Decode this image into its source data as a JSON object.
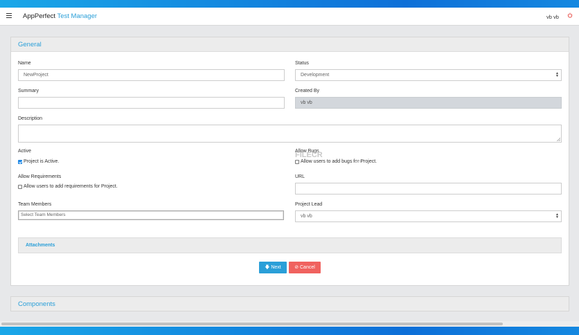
{
  "app": {
    "brand_main": "AppPerfect",
    "brand_accent": "Test Manager",
    "user": "vb vb",
    "accent_color": "#2a9fd8",
    "power_icon": "power-icon",
    "menu_icon": "hamburger-icon"
  },
  "general": {
    "title": "General",
    "name_label": "Name",
    "name_value": "NewProject",
    "status_label": "Status",
    "status_value": "Development",
    "summary_label": "Summary",
    "summary_value": "",
    "created_by_label": "Created By",
    "created_by_value": "vb vb",
    "description_label": "Description",
    "active_label": "Active",
    "active_checkbox_label": "Project is Active.",
    "active_checked": true,
    "allow_bugs_label": "Allow Bugs",
    "allow_bugs_checkbox_label": "Allow users to add bugs for Project.",
    "allow_bugs_checked": false,
    "allow_req_label": "Allow Requirements",
    "allow_req_checkbox_label": "Allow users to add requirements for Project.",
    "allow_req_checked": false,
    "url_label": "URL",
    "url_value": "",
    "team_label": "Team Members",
    "team_placeholder": "Select Team Members",
    "lead_label": "Project Lead",
    "lead_value": "vb vb",
    "attachments": "Attachments",
    "next_button": "🡇 Next",
    "cancel_button": "⊘ Cancel"
  },
  "watermark": {
    "text": "FILECR",
    "suffix": ".com"
  },
  "components": {
    "title": "Components"
  }
}
